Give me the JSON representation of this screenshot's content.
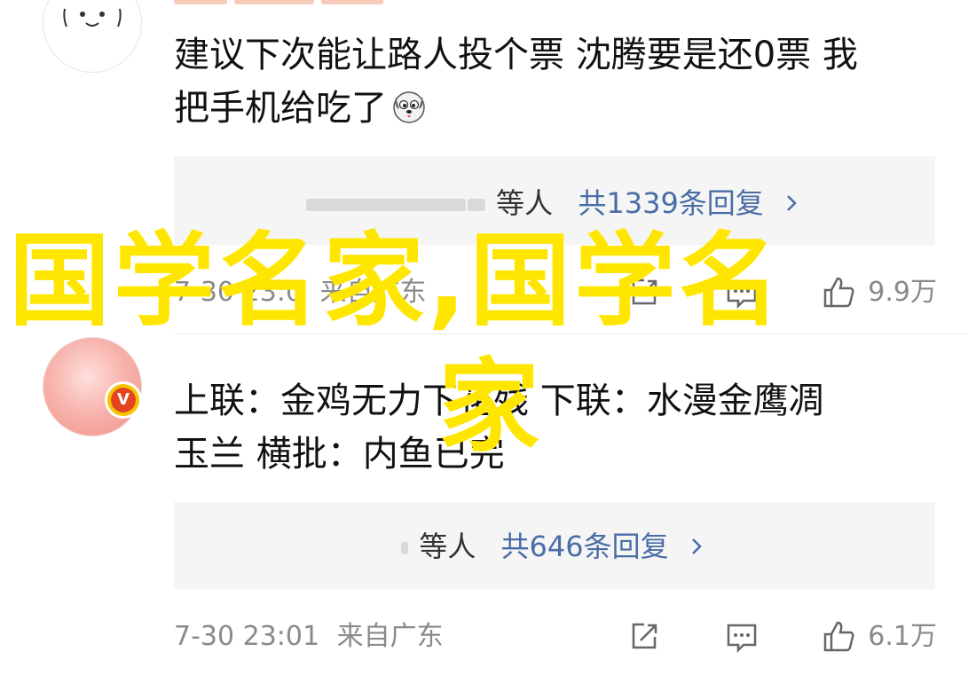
{
  "comments": [
    {
      "text_line1": "建议下次能让路人投个票 沈腾要是还0票 我",
      "text_line2": "把手机给吃了",
      "emoji": "dog-face-emoji",
      "replies": {
        "others": "等人",
        "count": "共1339条回复",
        "chevron": "chevron-right-icon"
      },
      "meta": {
        "time": "7-30 23:0",
        "location": "来自广东",
        "likes": "9.9万"
      }
    },
    {
      "text_line1": "上联：金鸡无力下花残 下联：水漫金鹰凋",
      "text_line2": "玉兰 横批：内鱼已完",
      "badge": "V",
      "replies": {
        "others": "等人",
        "count": "共646条回复",
        "chevron": "chevron-right-icon"
      },
      "meta": {
        "time": "7-30 23:01",
        "location": "来自广东",
        "likes": "6.1万"
      }
    }
  ],
  "icons": {
    "share": "share-icon",
    "comment": "comment-icon",
    "like": "thumbs-up-icon"
  },
  "watermark": {
    "line1": "国学名家,国学名",
    "line2": "家",
    "color": "#ffe600"
  },
  "colors": {
    "reply_link": "#4a6da7",
    "meta_gray": "#8a8a8a",
    "reply_bg": "#f5f5f5"
  }
}
